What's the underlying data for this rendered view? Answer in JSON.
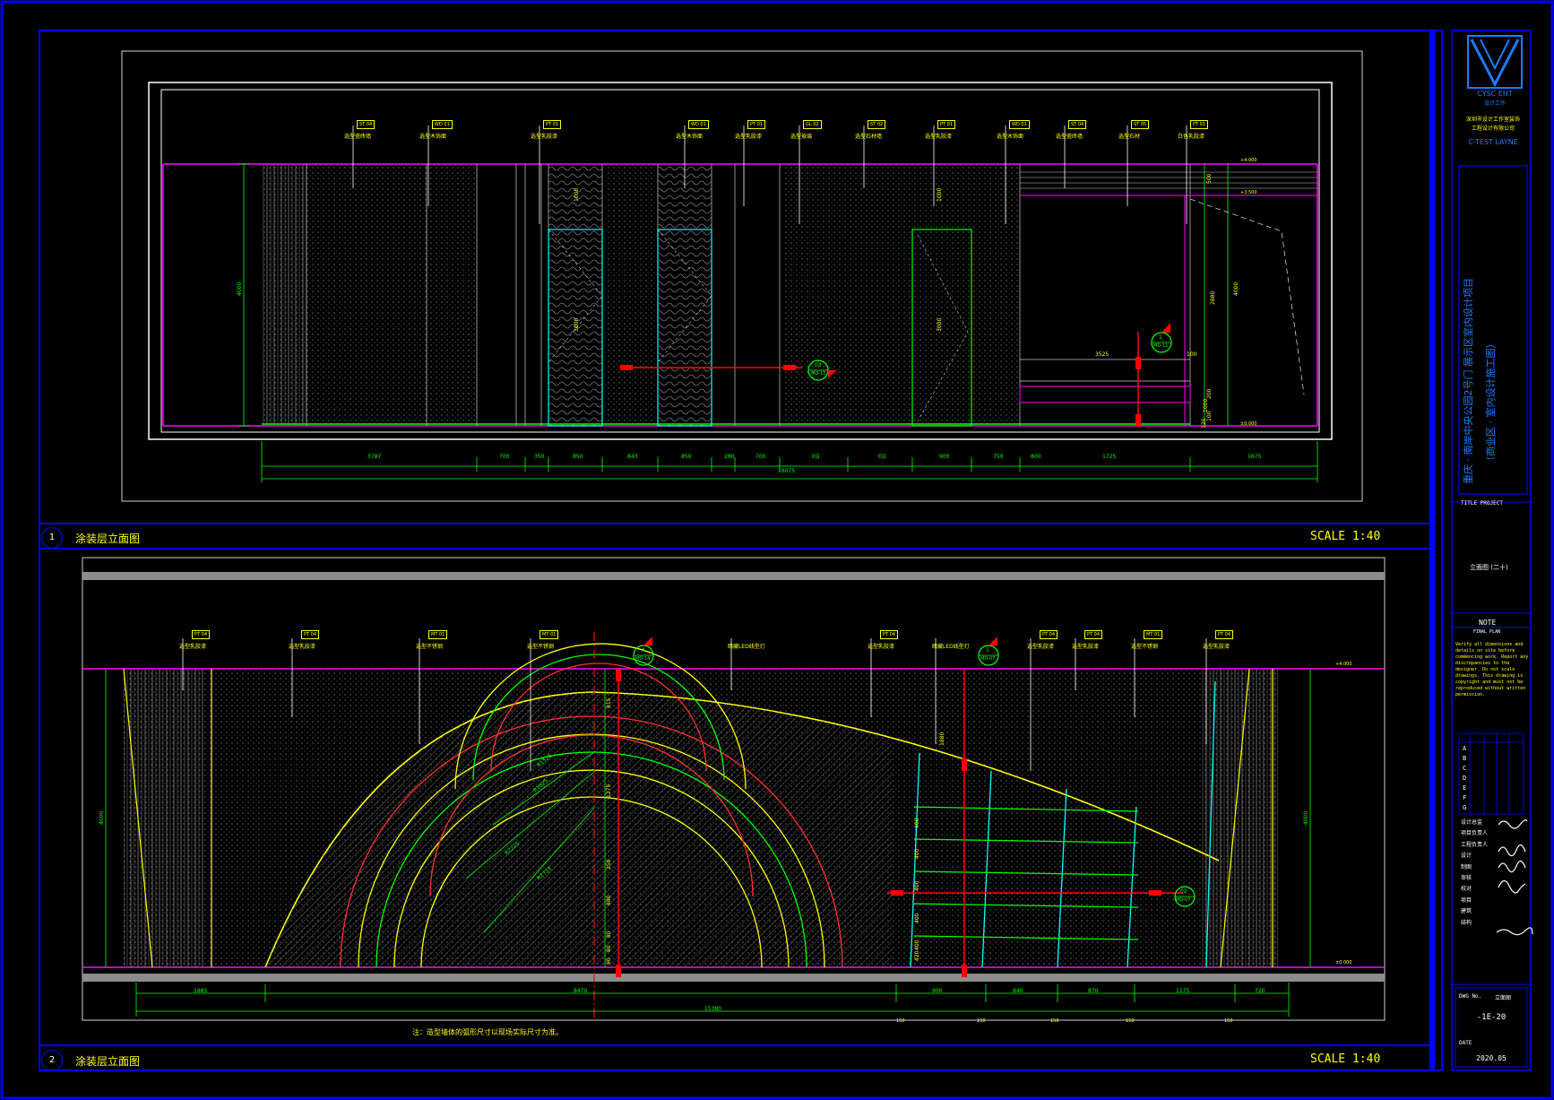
{
  "colors": {
    "frame": "#0000ff",
    "white": "#ffffff",
    "magenta": "#ff00ff",
    "green": "#00ff00",
    "yellow": "#ffff00",
    "cyan": "#00ffff",
    "red": "#ff0000",
    "grey": "#8c8c8c"
  },
  "elevation1": {
    "label_number": "1",
    "title": "涂装层立面图",
    "scale": "SCALE 1:40",
    "height_dim": "4000",
    "tags": [
      {
        "code": "ST 04",
        "note": "选型瓷砖墙"
      },
      {
        "code": "WD 01",
        "note": "选型木饰面"
      },
      {
        "code": "PT 01",
        "note": "选型乳胶漆"
      },
      {
        "code": "WD 01",
        "note": "选型木饰面"
      },
      {
        "code": "PT 01",
        "note": "选型乳胶漆"
      },
      {
        "code": "GL 02",
        "note": "选型玻璃"
      },
      {
        "code": "ST 02",
        "note": "选型石材墙"
      },
      {
        "code": "PT 01",
        "note": "选型乳胶漆"
      },
      {
        "code": "WD 01",
        "note": "选型木饰面"
      },
      {
        "code": "ST 04",
        "note": "选型瓷砖墙"
      },
      {
        "code": "ST 05",
        "note": "选型石材"
      },
      {
        "code": "PT 01",
        "note": "白色乳胶漆"
      }
    ],
    "dims": [
      "3787",
      "700",
      "350",
      "850",
      "843",
      "850",
      "280",
      "700",
      "EQ",
      "EQ",
      "900",
      "750",
      "800",
      "1725",
      "1675"
    ],
    "total_dim": "16075",
    "inner_dims": [
      "1000",
      "3000",
      "1000",
      "3000",
      "3525",
      "100",
      "500",
      "2880",
      "4000",
      "200",
      "1000",
      "100",
      "120"
    ],
    "callouts": [
      {
        "num": "03",
        "sheet": "MD-12"
      },
      {
        "num": "1",
        "sheet": "MD-11"
      }
    ],
    "levels": [
      "+4.000",
      "+3.500",
      "±0.000",
      "±0.000"
    ]
  },
  "elevation2": {
    "label_number": "2",
    "title": "涂装层立面图",
    "scale": "SCALE 1:40",
    "height_dim_left": "4000",
    "height_dim_right": "4000",
    "tags": [
      {
        "code": "PT 04",
        "note": "选型乳胶漆"
      },
      {
        "code": "PT 04",
        "note": "选型乳胶漆"
      },
      {
        "code": "MT 01",
        "note": "选型不锈钢"
      },
      {
        "code": "MT 01",
        "note": "选型不锈钢"
      },
      {
        "code": "",
        "note": "暗藏LED线型灯"
      },
      {
        "code": "PT 04",
        "note": "选型乳胶漆"
      },
      {
        "code": "",
        "note": "暗藏LED线型灯"
      },
      {
        "code": "PT 04",
        "note": "选型乳胶漆"
      },
      {
        "code": "PT 04",
        "note": "选型乳胶漆"
      },
      {
        "code": "MT 01",
        "note": "选型不锈钢"
      },
      {
        "code": "PT 04",
        "note": "选型乳胶漆"
      }
    ],
    "radii": [
      "R1525",
      "R1825",
      "R2225",
      "R2725"
    ],
    "vert_dims": [
      "815",
      "1275",
      "250",
      "880",
      "80",
      "80",
      "90"
    ],
    "shelf_dims": [
      "400",
      "400",
      "400",
      "400",
      "400",
      "420",
      "1880"
    ],
    "dims": [
      "1885",
      "8470",
      "900",
      "840",
      "870",
      "1175",
      "720"
    ],
    "total_dim": "15380",
    "small_dims": [
      "150",
      "150",
      "150",
      "150",
      "150"
    ],
    "callouts": [
      {
        "num": "A",
        "sheet": "MD-14"
      },
      {
        "num": "1",
        "sheet": "MD-07"
      },
      {
        "num": "02",
        "sheet": "MD-07"
      }
    ],
    "levels": [
      "+4.000",
      "±0.000"
    ],
    "footnote": "注：造型墙体的弧形尺寸以现场实际尺寸为准。"
  },
  "titleblock": {
    "logo_text": "CYSC EHT",
    "logo_sub": "设计工作",
    "company_lines": [
      "深圳市设计工作室装饰",
      "工程设计有限公司"
    ],
    "company_en": "C-TEST LAYNE",
    "project_title_1": "重庆 · 南岸中央公园2号门 展示区室内设计项目",
    "project_title_2": "（商业区 · 室内设计施工图）",
    "labels": {
      "title_project": "TITLE PROJECT",
      "drawing_title": "立面图 (二十)",
      "note": "NOTE",
      "note_sub": "FINAL PLAN",
      "dwg_no": "DWG No.",
      "date": "DATE"
    },
    "note_text": "Verify all dimensions and details on site before commencing work. Report any discrepancies to the designer. Do not scale drawings. This drawing is copyright and must not be reproduced without written permission.",
    "revisions": [
      "A",
      "B",
      "C",
      "D",
      "E",
      "F",
      "G"
    ],
    "signoff_rows": [
      "设计总监",
      "项目负责人",
      "工程负责人",
      "设计",
      "制图",
      "审核",
      "校对",
      "项目",
      "建筑",
      "结构"
    ],
    "drawing_no": "-1E-20",
    "sheet_label": "立面图",
    "date_value": "2020.05"
  }
}
